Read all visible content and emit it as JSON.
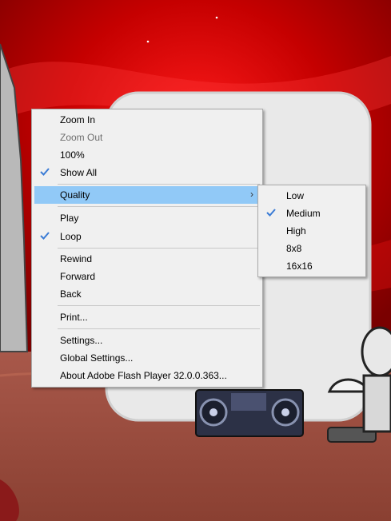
{
  "context_menu": {
    "items": [
      {
        "label": "Zoom In"
      },
      {
        "label": "Zoom Out",
        "disabled": true
      },
      {
        "label": "100%"
      },
      {
        "label": "Show All",
        "checked": true
      },
      {
        "label": "Quality",
        "has_submenu": true,
        "highlighted": true
      },
      {
        "label": "Play"
      },
      {
        "label": "Loop",
        "checked": true
      },
      {
        "label": "Rewind"
      },
      {
        "label": "Forward"
      },
      {
        "label": "Back"
      },
      {
        "label": "Print..."
      },
      {
        "label": "Settings..."
      },
      {
        "label": "Global Settings..."
      },
      {
        "label": "About Adobe Flash Player 32.0.0.363..."
      }
    ]
  },
  "quality_submenu": {
    "items": [
      {
        "label": "Low"
      },
      {
        "label": "Medium",
        "checked": true
      },
      {
        "label": "High"
      },
      {
        "label": "8x8"
      },
      {
        "label": "16x16"
      }
    ]
  },
  "colors": {
    "highlight": "#91c9f7",
    "checkmark": "#3a7bd5",
    "menu_bg": "#f0f0f0"
  }
}
